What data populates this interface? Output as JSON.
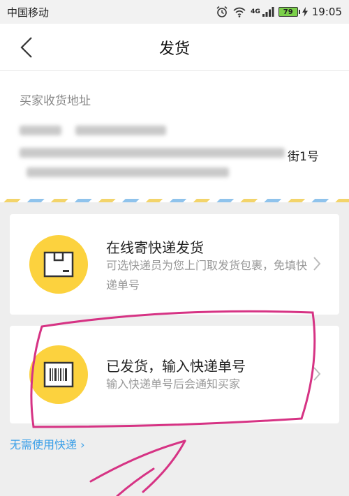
{
  "status_bar": {
    "carrier": "中国移动",
    "network": "4G",
    "battery": "79",
    "time": "19:05"
  },
  "nav": {
    "title": "发货"
  },
  "address": {
    "label": "买家收货地址",
    "visible_suffix": "街1号"
  },
  "options": [
    {
      "title": "在线寄快递发货",
      "desc": "可选快递员为您上门取发货包裹，免填快递单号",
      "icon": "package-box-icon"
    },
    {
      "title": "已发货，输入快递单号",
      "desc": "输入快递单号后会通知买家",
      "icon": "barcode-icon"
    }
  ],
  "no_express_link": "无需使用快递 ›",
  "colors": {
    "accent_yellow": "#fcd23e",
    "link_blue": "#3a9fe8",
    "annotation": "#d63384"
  }
}
